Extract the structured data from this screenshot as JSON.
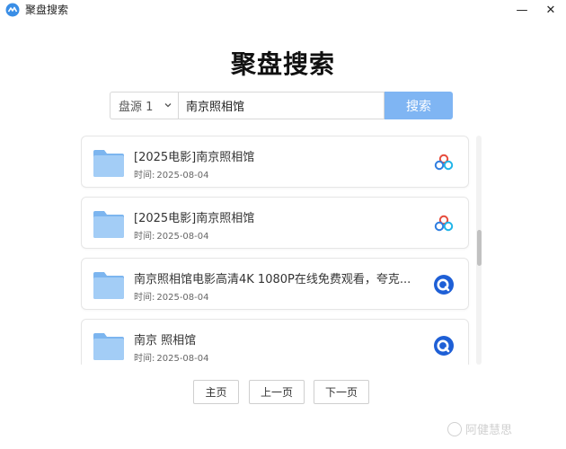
{
  "window": {
    "title": "聚盘搜索",
    "minimize_glyph": "—",
    "close_glyph": "✕"
  },
  "header": {
    "title": "聚盘搜索"
  },
  "search": {
    "source_selected": "盘源 1",
    "query": "南京照相馆",
    "button_label": "搜索"
  },
  "results": [
    {
      "title": "[2025电影]南京照相馆",
      "time_label": "时间:",
      "time": "2025-08-04",
      "source_icon": "baidu-pan-icon"
    },
    {
      "title": "[2025电影]南京照相馆",
      "time_label": "时间:",
      "time": "2025-08-04",
      "source_icon": "baidu-pan-icon"
    },
    {
      "title": "南京照相馆电影高清4K 1080P在线免费观看，夸克...",
      "time_label": "时间:",
      "time": "2025-08-04",
      "source_icon": "quark-pan-icon"
    },
    {
      "title": "南京 照相馆",
      "time_label": "时间:",
      "time": "2025-08-04",
      "source_icon": "quark-pan-icon"
    }
  ],
  "pagination": {
    "home": "主页",
    "prev": "上一页",
    "next": "下一页"
  },
  "watermark": {
    "text": "阿健慧思"
  },
  "colors": {
    "accent": "#7fb5f3",
    "folder": "#8fc1f3",
    "quark_blue": "#1e5fd6"
  }
}
